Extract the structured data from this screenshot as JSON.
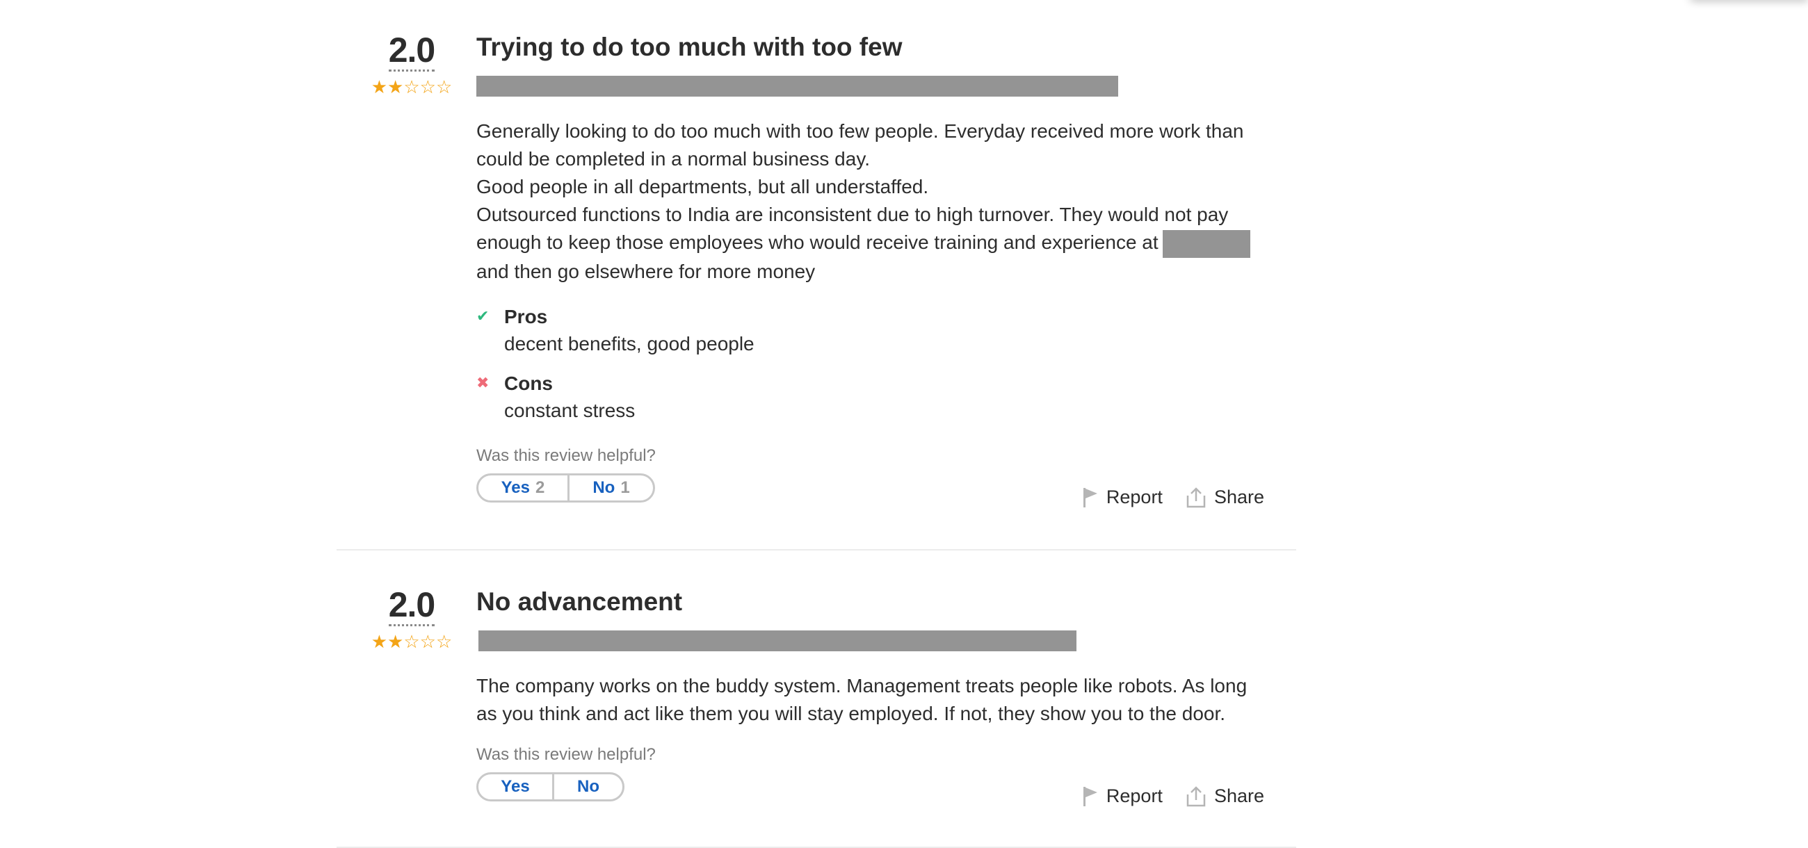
{
  "reviews": [
    {
      "rating": "2.0",
      "stars_filled": 2,
      "stars_total": 5,
      "title": "Trying to do too much with too few",
      "body": [
        "Generally looking to do too much with too few people. Everyday received more work than could be completed in a normal business day.",
        "Good people in all departments, but all understaffed.",
        "Outsourced functions to India are inconsistent due to high turnover. They would not pay enough to keep those employees who would receive training and experience at",
        "and then go elsewhere for more money"
      ],
      "pros_label": "Pros",
      "pros_text": "decent benefits, good people",
      "cons_label": "Cons",
      "cons_text": "constant stress",
      "helpful_label": "Was this review helpful?",
      "yes_label": "Yes",
      "yes_count": "2",
      "no_label": "No",
      "no_count": "1",
      "report_label": "Report",
      "share_label": "Share"
    },
    {
      "rating": "2.0",
      "stars_filled": 2,
      "stars_total": 5,
      "title": "No advancement",
      "body": [
        "The company works on the buddy system. Management treats people like robots. As long as you think and act like them you will stay employed. If not, they show you to the door."
      ],
      "helpful_label": "Was this review helpful?",
      "yes_label": "Yes",
      "no_label": "No",
      "report_label": "Report",
      "share_label": "Share"
    }
  ],
  "colors": {
    "star": "#f3a417",
    "link_blue": "#1861bf",
    "check_green": "#2db87d",
    "cross_red": "#ee6b78",
    "redaction": "#949494"
  },
  "icons": {
    "flag": "flag-icon",
    "share": "share-icon",
    "check": "check-icon",
    "cross": "close-icon",
    "star": "star-icon"
  }
}
